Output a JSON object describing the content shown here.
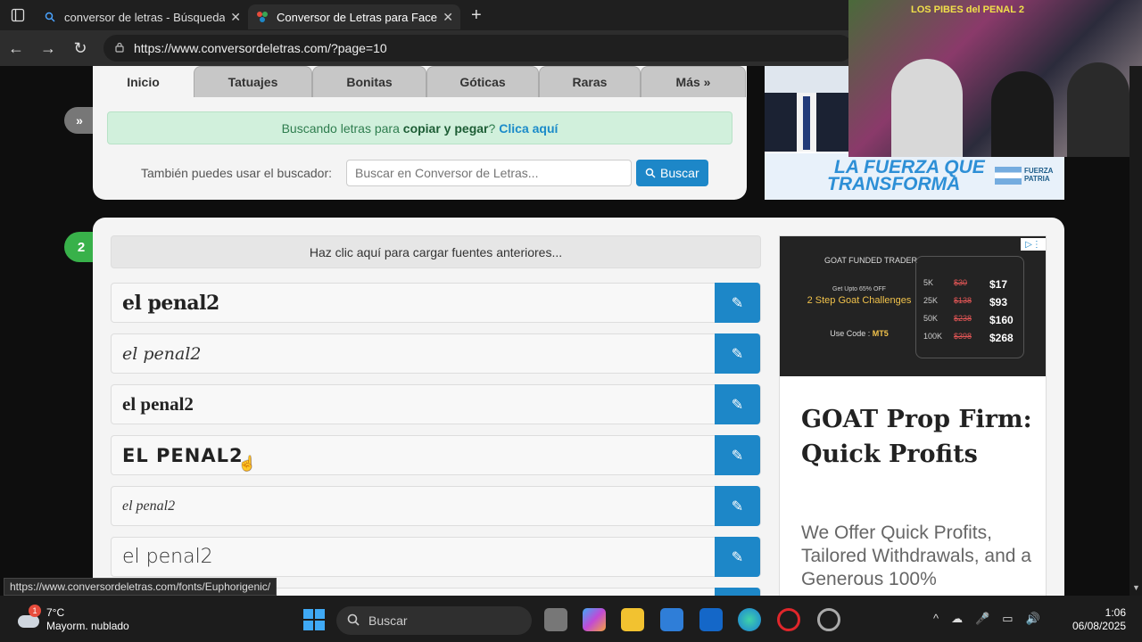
{
  "browser": {
    "tabs": [
      {
        "title": "conversor de letras - Búsqueda",
        "close": "✕"
      },
      {
        "title": "Conversor de Letras para Facebook",
        "close": "✕"
      }
    ],
    "new_tab": "+",
    "url": "https://www.conversordeletras.com/?page=10",
    "status_url": "https://www.conversordeletras.com/fonts/Euphorigenic/"
  },
  "site": {
    "nav_tabs": [
      "Inicio",
      "Tatuajes",
      "Bonitas",
      "Góticas",
      "Raras",
      "Más »"
    ],
    "collapse_label": "»",
    "alert": {
      "prefix": "Buscando letras para",
      "bold": "copiar y pegar",
      "suffix": "?",
      "link": "Clica aquí"
    },
    "search": {
      "label": "También puedes usar el buscador:",
      "placeholder": "Buscar en Conversor de Letras...",
      "button": "Buscar"
    },
    "step_number": "2",
    "load_previous": "Haz clic aquí para cargar fuentes anteriores...",
    "font_samples": [
      "el penal2",
      "el penal2",
      "el penal2",
      "EL PENAL2",
      "el penal2",
      "el penal2"
    ]
  },
  "ads": {
    "top": {
      "slogan_line1": "LA FUERZA QUE",
      "slogan_line2": "TRANSFORMA",
      "party_line1": "FUERZA",
      "party_line2": "PATRIA"
    },
    "side": {
      "brand": "GOAT FUNDED TRADER",
      "promo_small": "Get Upto 65% OFF",
      "promo_title": "2 Step Goat Challenges",
      "code_label": "Use Code :",
      "code": "MT5",
      "pricing": [
        {
          "size": "5K",
          "old": "$30",
          "new": "$17"
        },
        {
          "size": "25K",
          "old": "$138",
          "new": "$93"
        },
        {
          "size": "50K",
          "old": "$238",
          "new": "$160"
        },
        {
          "size": "100K",
          "old": "$398",
          "new": "$268"
        }
      ],
      "headline": "GOAT Prop Firm: Quick Profits",
      "body": "We Offer Quick Profits, Tailored Withdrawals, and a Generous 100%"
    }
  },
  "webcam": {
    "graffiti": "LOS PIBES del PENAL 2"
  },
  "taskbar": {
    "weather_badge": "1",
    "temperature": "7°C",
    "condition": "Mayorm. nublado",
    "search_placeholder": "Buscar",
    "time": "1:06",
    "date": "06/08/2025"
  }
}
